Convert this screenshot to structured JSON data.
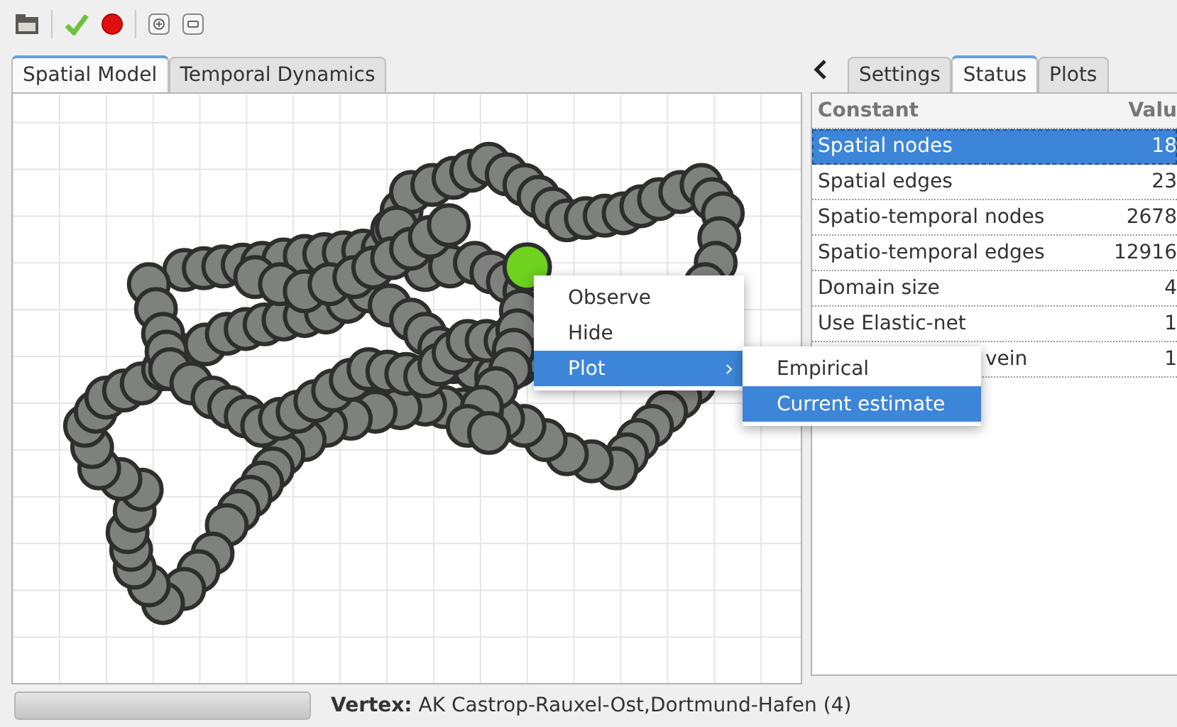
{
  "left_tabs": [
    {
      "label": "Spatial Model",
      "selected": true
    },
    {
      "label": "Temporal Dynamics",
      "selected": false
    }
  ],
  "right_tabs": [
    {
      "label": "Settings",
      "selected": false
    },
    {
      "label": "Status",
      "selected": true
    },
    {
      "label": "Plots",
      "selected": false
    }
  ],
  "table": {
    "columns": [
      "Constant",
      "Valu"
    ],
    "rows": [
      {
        "cells": [
          "Spatial nodes",
          "18"
        ],
        "selected": true
      },
      {
        "cells": [
          "Spatial edges",
          "23"
        ],
        "selected": false
      },
      {
        "cells": [
          "Spatio-temporal nodes",
          "2678"
        ],
        "selected": false
      },
      {
        "cells": [
          "Spatio-temporal edges",
          "12916"
        ],
        "selected": false
      },
      {
        "cells": [
          "Domain size",
          "4"
        ],
        "selected": false
      },
      {
        "cells": [
          "Use Elastic-net",
          "1"
        ],
        "selected": false
      },
      {
        "cells": [
          "vein",
          "1"
        ],
        "selected": false
      }
    ]
  },
  "context_menu": {
    "items": [
      {
        "label": "Observe",
        "selected": false,
        "submenu": false
      },
      {
        "label": "Hide",
        "selected": false,
        "submenu": false
      },
      {
        "label": "Plot",
        "selected": true,
        "submenu": true
      }
    ]
  },
  "submenu": {
    "items": [
      {
        "label": "Empirical",
        "selected": false
      },
      {
        "label": "Current estimate",
        "selected": true
      }
    ]
  },
  "status_bar": {
    "progress": {
      "level": 0
    },
    "label": "Vertex:",
    "value": "AK Castrop-Rauxel-Ost,Dortmund-Hafen (4)"
  }
}
